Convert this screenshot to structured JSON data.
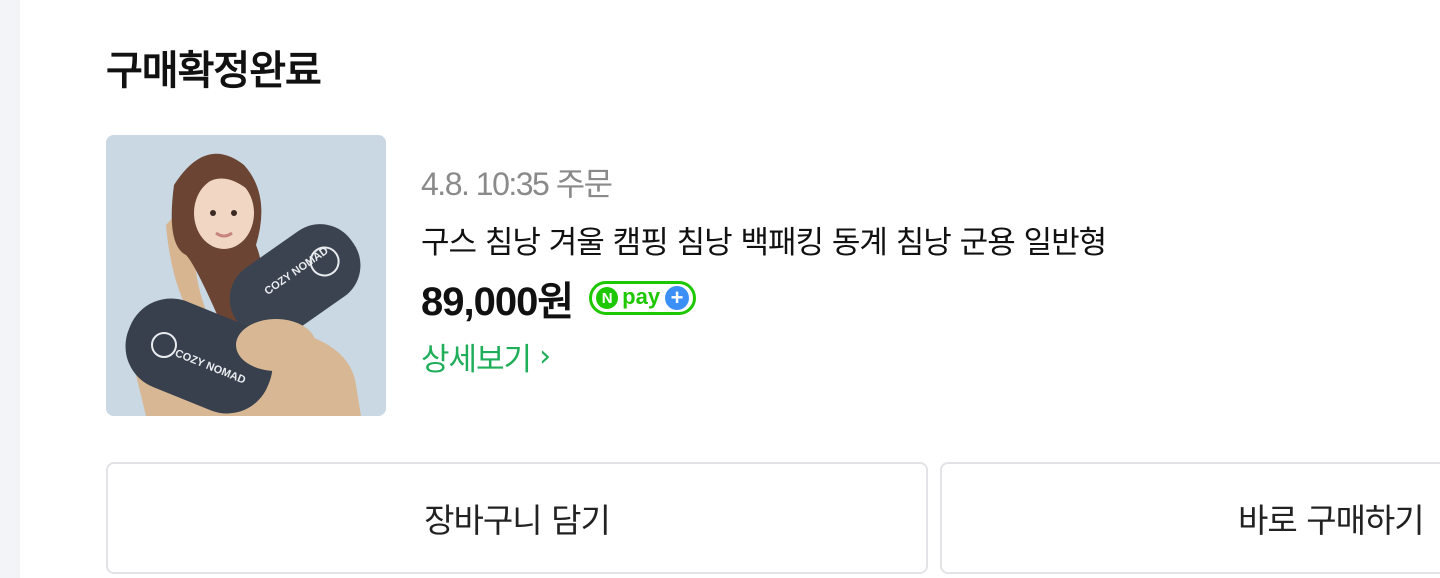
{
  "order": {
    "status_title": "구매확정완료",
    "date": "4.8. 10:35 주문",
    "product_name": "구스 침낭 겨울 캠핑 침낭 백패킹 동계 침낭 군용 일반형",
    "price": "89,000원",
    "detail_link": "상세보기",
    "thumbnail_icon": "product-photo-sleeping-bag",
    "thumbnail_print": "COZY NOMAD"
  },
  "badge": {
    "n": "N",
    "text": "pay",
    "plus": "+"
  },
  "buttons": {
    "cart": "장바구니 담기",
    "buy": "바로 구매하기"
  },
  "colors": {
    "accent_green": "#1fae5a",
    "npay_green": "#1ec800",
    "npay_blue": "#3c8ff5"
  }
}
